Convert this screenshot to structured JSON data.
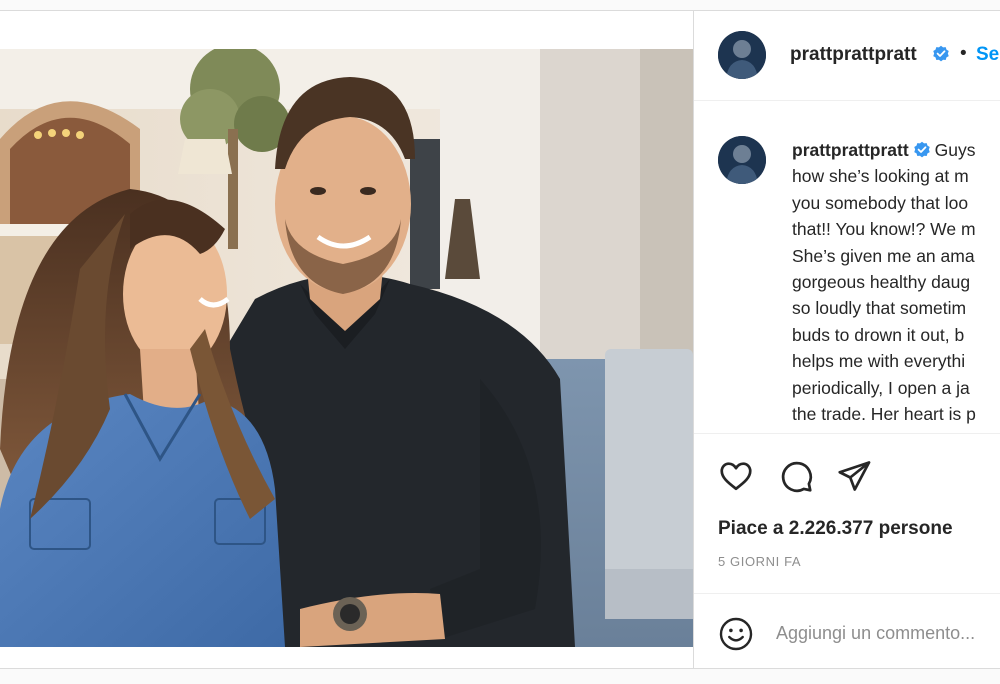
{
  "post": {
    "photo_alt": "",
    "author": {
      "username": "prattprattpratt",
      "verified": true,
      "follow_label": "Segui"
    },
    "caption": {
      "username": "prattprattpratt",
      "lines": [
        "Guys",
        "how she’s looking at m",
        "you somebody that loo",
        "that!! You know!? We m",
        "She’s given me an ama",
        "gorgeous healthy daug",
        "so loudly that sometim",
        "buds to drown it out, b",
        "helps me with everythi",
        "periodically, I open a ja",
        "the trade. Her heart is p"
      ]
    },
    "icons": {
      "like": "heart-icon",
      "comment": "comment-bubble-icon",
      "share": "paper-plane-icon",
      "emoji": "smiley-icon",
      "verified": "verified-badge-icon"
    },
    "likes": {
      "prefix": "Piace a",
      "count": "2.226.377",
      "suffix": "persone"
    },
    "date": "5 GIORNI FA",
    "comment_placeholder": "Aggiungi un commento..."
  },
  "colors": {
    "accent": "#0095f6",
    "verified": "#3897f0",
    "text": "#262626",
    "muted": "#8e8e8e"
  }
}
